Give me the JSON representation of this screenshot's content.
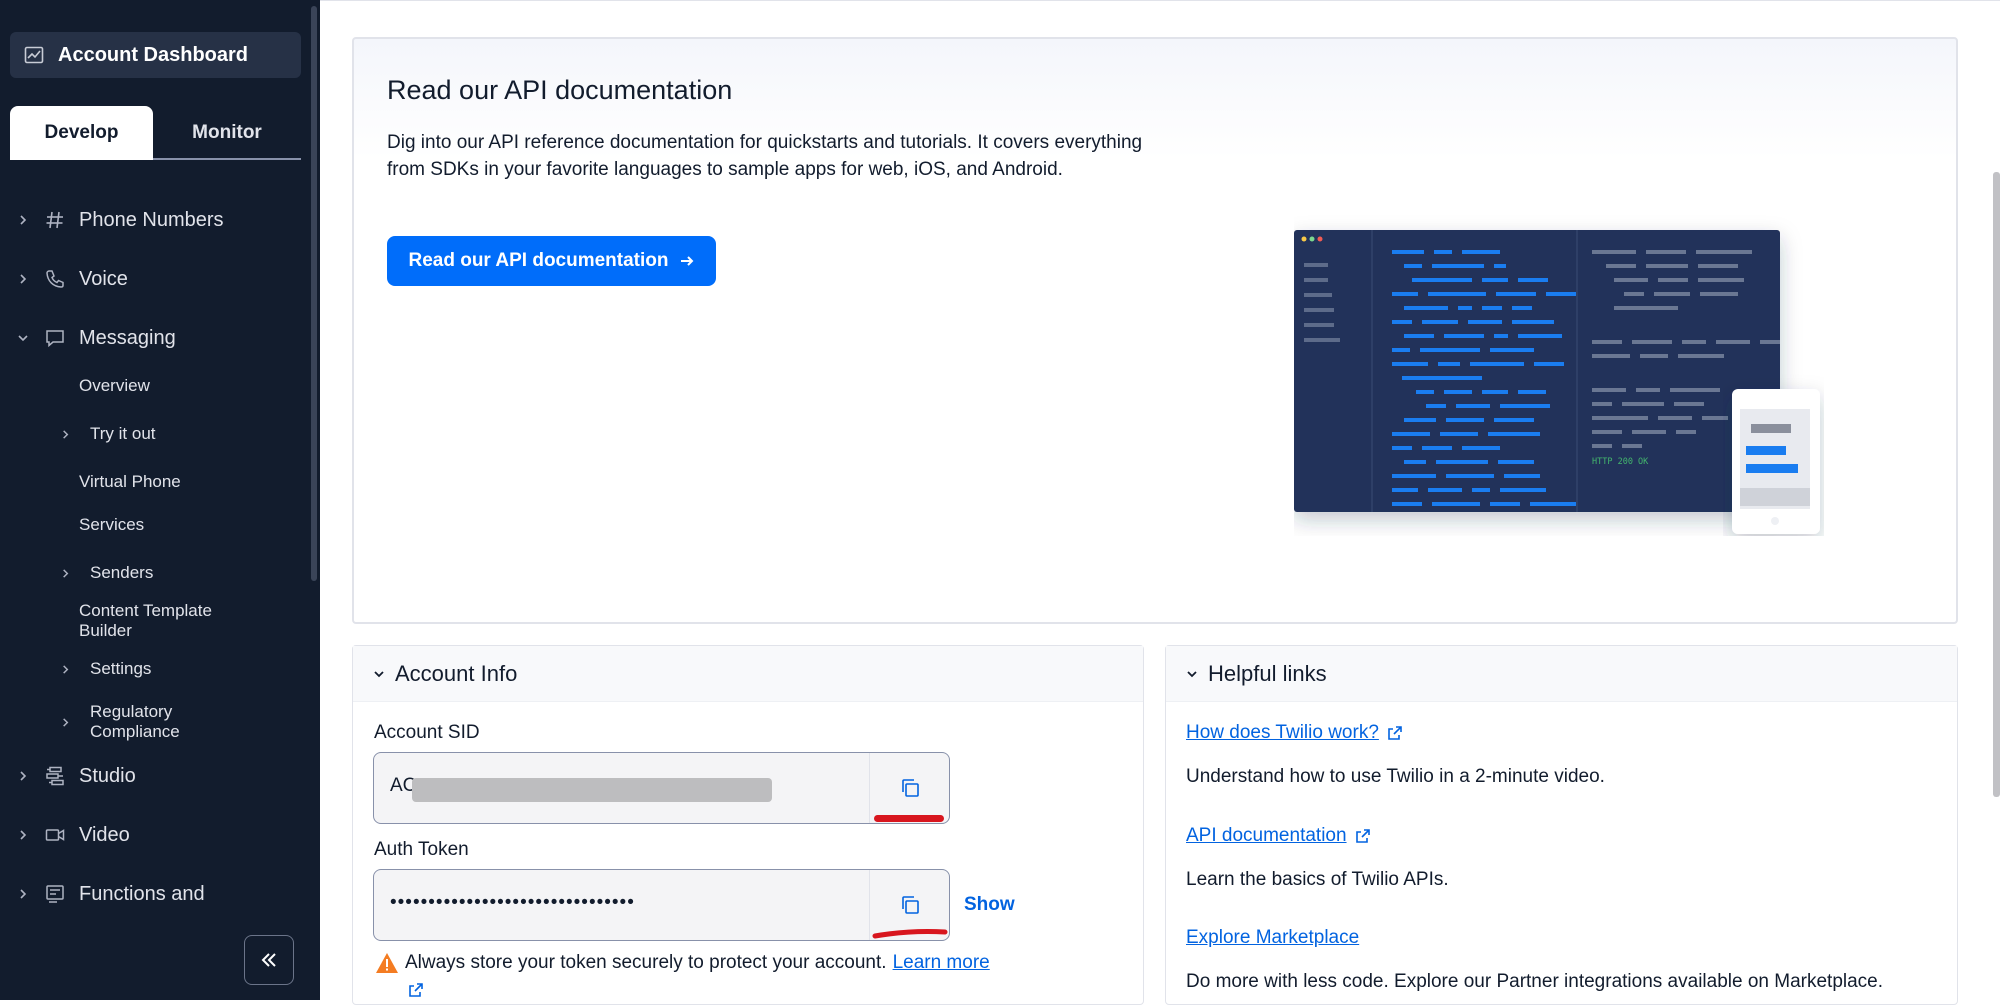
{
  "sidebar": {
    "dashboard_label": "Account Dashboard",
    "tabs": [
      {
        "label": "Develop",
        "active": true
      },
      {
        "label": "Monitor",
        "active": false
      }
    ],
    "nav": [
      {
        "label": "Phone Numbers",
        "icon": "hash-icon",
        "expanded": false
      },
      {
        "label": "Voice",
        "icon": "phone-icon",
        "expanded": false
      },
      {
        "label": "Messaging",
        "icon": "chat-bubble-icon",
        "expanded": true
      },
      {
        "label": "Studio",
        "icon": "flow-icon",
        "expanded": false
      },
      {
        "label": "Video",
        "icon": "video-icon",
        "expanded": false
      },
      {
        "label": "Functions and",
        "icon": "functions-icon",
        "expanded": false
      }
    ],
    "messaging_sub": [
      {
        "label": "Overview",
        "has_children": false
      },
      {
        "label": "Try it out",
        "has_children": true
      },
      {
        "label": "Virtual Phone",
        "has_children": false
      },
      {
        "label": "Services",
        "has_children": false
      },
      {
        "label": "Senders",
        "has_children": true
      },
      {
        "label": "Content Template Builder",
        "has_children": false
      },
      {
        "label": "Settings",
        "has_children": true
      },
      {
        "label": "Regulatory Compliance",
        "has_children": true
      }
    ],
    "collapse_icon": "double-chevron-left-icon"
  },
  "api_card": {
    "title": "Read our API documentation",
    "description": "Dig into our API reference documentation for quickstarts and tutorials. It covers everything from SDKs in your favorite languages to sample apps for web, iOS, and Android.",
    "button_label": "Read our API documentation",
    "illustration_status": "HTTP 200 OK"
  },
  "account_info": {
    "title": "Account Info",
    "sid_label": "Account SID",
    "sid_prefix": "AC",
    "token_label": "Auth Token",
    "token_value": "••••••••••••••••••••••••••••••••",
    "show_label": "Show",
    "warning_text": "Always store your token securely to protect your account.",
    "learn_more": "Learn more"
  },
  "helpful_links": {
    "title": "Helpful links",
    "items": [
      {
        "link": "How does Twilio work?",
        "desc": "Understand how to use Twilio in a 2-minute video."
      },
      {
        "link": "API documentation",
        "desc": "Learn the basics of Twilio APIs."
      },
      {
        "link": "Explore Marketplace",
        "desc": "Do more with less code. Explore our Partner integrations available on Marketplace."
      }
    ]
  },
  "colors": {
    "sidebar_bg": "#121c2d",
    "primary": "#006dfa",
    "link": "#0263e0",
    "annotation_red": "#d8161e",
    "warning": "#f47c22"
  }
}
